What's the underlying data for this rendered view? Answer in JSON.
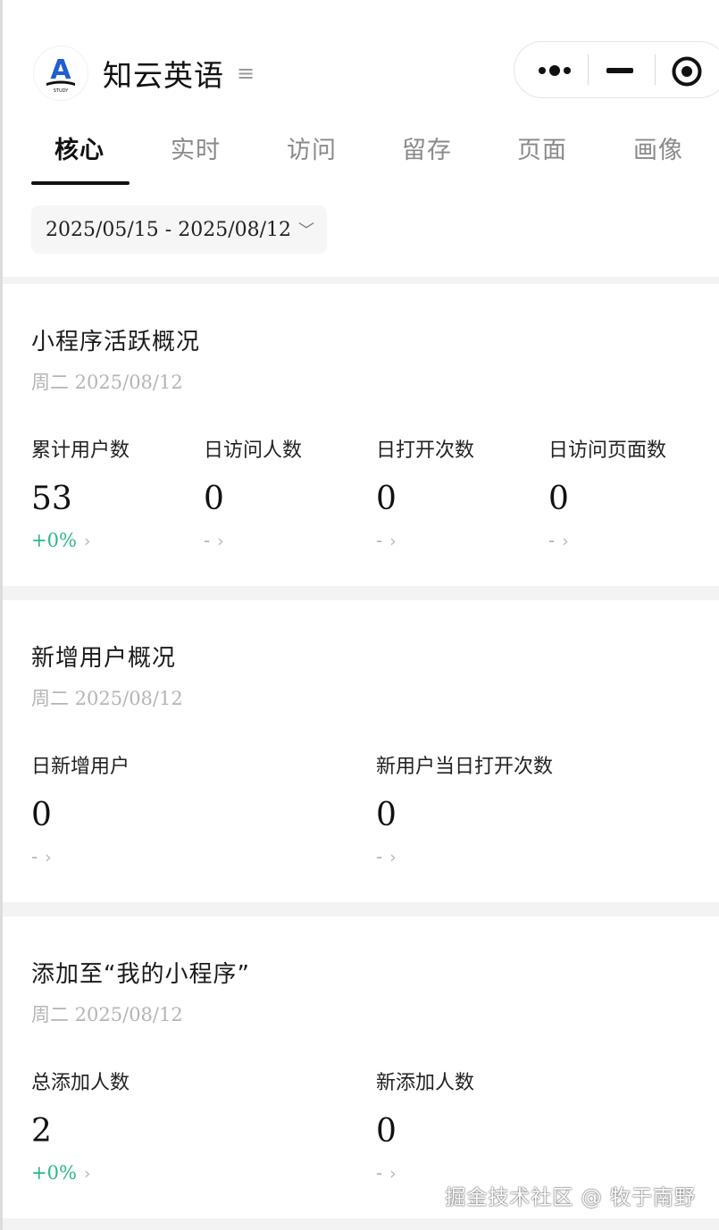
{
  "app": {
    "title": "知云英语",
    "menu_glyph": "≡",
    "logo_letter": "A",
    "logo_caption": "STUDY",
    "brand_color": "#1f5fd1"
  },
  "capsule": {
    "more_icon": "more-dots-icon",
    "minimize_icon": "minimize-icon",
    "close_icon": "target-close-icon"
  },
  "tabs": [
    {
      "label": "核心",
      "active": true
    },
    {
      "label": "实时"
    },
    {
      "label": "访问"
    },
    {
      "label": "留存"
    },
    {
      "label": "页面"
    },
    {
      "label": "画像"
    }
  ],
  "date_range": {
    "label": "2025/05/15 - 2025/08/12",
    "chevron": "﹀"
  },
  "cards": [
    {
      "title": "小程序活跃概况",
      "date": "周二 2025/08/12",
      "metrics": [
        {
          "label": "累计用户数",
          "value": "53",
          "trend": "+0%",
          "arrow": "›"
        },
        {
          "label": "日访问人数",
          "value": "0",
          "trend": "-",
          "arrow": "›"
        },
        {
          "label": "日打开次数",
          "value": "0",
          "trend": "-",
          "arrow": "›"
        },
        {
          "label": "日访问页面数",
          "value": "0",
          "trend": "-",
          "arrow": "›"
        }
      ]
    },
    {
      "title": "新增用户概况",
      "date": "周二 2025/08/12",
      "metrics": [
        {
          "label": "日新增用户",
          "value": "0",
          "trend": "-",
          "arrow": "›"
        },
        {
          "label": "新用户当日打开次数",
          "value": "0",
          "trend": "-",
          "arrow": "›"
        }
      ]
    },
    {
      "title": "添加至“我的小程序”",
      "date": "周二 2025/08/12",
      "metrics": [
        {
          "label": "总添加人数",
          "value": "2",
          "trend": "+0%",
          "arrow": "›"
        },
        {
          "label": "新添加人数",
          "value": "0",
          "trend": "-",
          "arrow": "›"
        }
      ]
    }
  ],
  "colors": {
    "trend_up": "#2cb58d",
    "muted": "#b5b5b5"
  },
  "watermark": "掘金技术社区 @ 牧于南野"
}
